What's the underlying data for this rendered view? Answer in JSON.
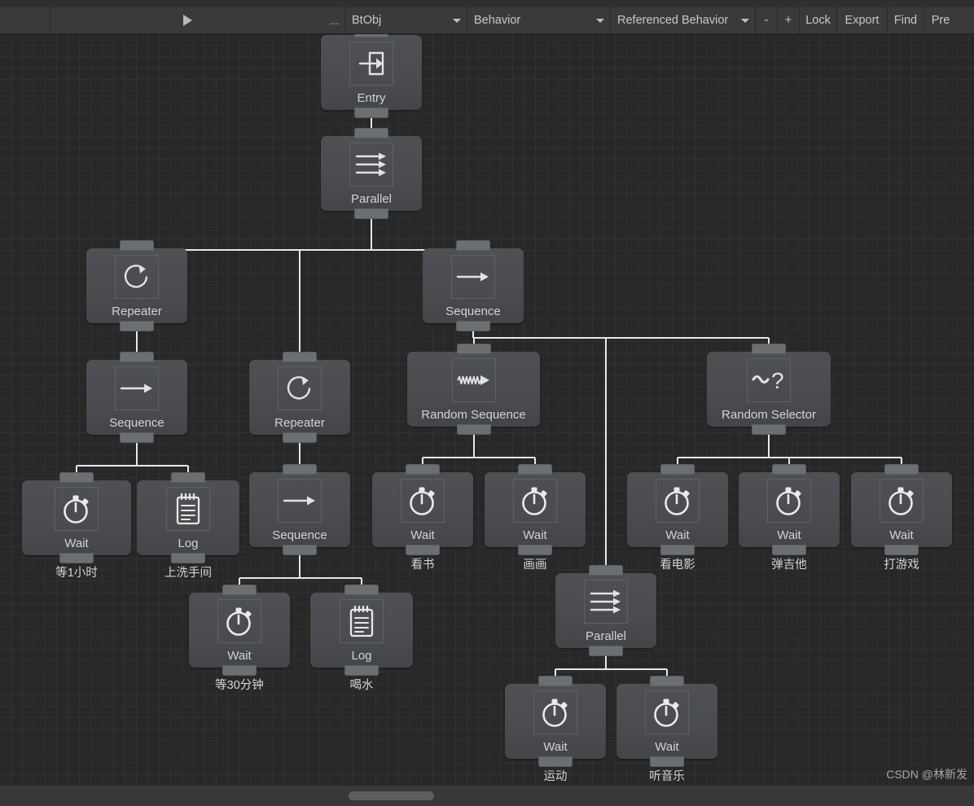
{
  "toolbar": {
    "play_icon": "play-icon",
    "dots_label": "...",
    "btobj_label": "BtObj",
    "behavior_label": "Behavior",
    "referenced_behavior_label": "Referenced Behavior",
    "minus_label": "-",
    "plus_label": "+",
    "lock_label": "Lock",
    "export_label": "Export",
    "find_label": "Find",
    "pref_label": "Pre"
  },
  "colors": {
    "canvas_bg": "#282828",
    "grid_line": "#313131",
    "node_fill": "#4a4c4f",
    "node_tab": "#6c6f72",
    "wire": "#e8e8e8",
    "toolbar_bg": "#3a3a3a",
    "text": "#d2d2d2"
  },
  "graph": {
    "nodes": [
      {
        "id": "entry",
        "label": "Entry",
        "icon": "entry-icon",
        "caption": ""
      },
      {
        "id": "parallel1",
        "label": "Parallel",
        "icon": "parallel-icon",
        "caption": ""
      },
      {
        "id": "repeater1",
        "label": "Repeater",
        "icon": "repeater-icon",
        "caption": ""
      },
      {
        "id": "sequence1",
        "label": "Sequence",
        "icon": "sequence-icon",
        "caption": ""
      },
      {
        "id": "wait1",
        "label": "Wait",
        "icon": "stopwatch-icon",
        "caption": "等1小时"
      },
      {
        "id": "log1",
        "label": "Log",
        "icon": "notepad-icon",
        "caption": "上洗手间"
      },
      {
        "id": "repeater2",
        "label": "Repeater",
        "icon": "repeater-icon",
        "caption": ""
      },
      {
        "id": "sequence2",
        "label": "Sequence",
        "icon": "sequence-icon",
        "caption": ""
      },
      {
        "id": "wait2",
        "label": "Wait",
        "icon": "stopwatch-icon",
        "caption": "等30分钟"
      },
      {
        "id": "log2",
        "label": "Log",
        "icon": "notepad-icon",
        "caption": "喝水"
      },
      {
        "id": "sequence3",
        "label": "Sequence",
        "icon": "sequence-icon",
        "caption": ""
      },
      {
        "id": "randseq",
        "label": "Random Sequence",
        "icon": "random-sequence-icon",
        "caption": ""
      },
      {
        "id": "wait3",
        "label": "Wait",
        "icon": "stopwatch-icon",
        "caption": "看书"
      },
      {
        "id": "wait4",
        "label": "Wait",
        "icon": "stopwatch-icon",
        "caption": "画画"
      },
      {
        "id": "randsel",
        "label": "Random Selector",
        "icon": "random-selector-icon",
        "caption": ""
      },
      {
        "id": "wait5",
        "label": "Wait",
        "icon": "stopwatch-icon",
        "caption": "看电影"
      },
      {
        "id": "wait6",
        "label": "Wait",
        "icon": "stopwatch-icon",
        "caption": "弹吉他"
      },
      {
        "id": "wait7",
        "label": "Wait",
        "icon": "stopwatch-icon",
        "caption": "打游戏"
      },
      {
        "id": "parallel2",
        "label": "Parallel",
        "icon": "parallel-icon",
        "caption": ""
      },
      {
        "id": "wait8",
        "label": "Wait",
        "icon": "stopwatch-icon",
        "caption": "运动"
      },
      {
        "id": "wait9",
        "label": "Wait",
        "icon": "stopwatch-icon",
        "caption": "听音乐"
      }
    ]
  },
  "watermark": "CSDN @林新发"
}
